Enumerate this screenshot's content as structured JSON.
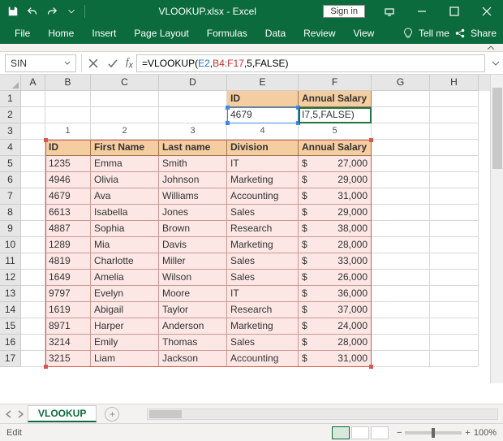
{
  "title": "VLOOKUP.xlsx - Excel",
  "signin": "Sign in",
  "tabs": [
    "File",
    "Home",
    "Insert",
    "Page Layout",
    "Formulas",
    "Data",
    "Review",
    "View"
  ],
  "tell_me": "Tell me",
  "share": "Share",
  "name_box": "SIN",
  "formula_prefix": "=VLOOKUP(",
  "formula_arg1": "E2",
  "formula_arg2": "B4:F17",
  "formula_rest": ",5,FALSE)",
  "col_headers": [
    "A",
    "B",
    "C",
    "D",
    "E",
    "F",
    "G",
    "H"
  ],
  "row_guides": [
    "1",
    "2",
    "3",
    "4",
    "5"
  ],
  "lookup": {
    "id_label": "ID",
    "salary_label": "Annual Salary",
    "id_value": "4679",
    "editing": "I7,5,FALSE)"
  },
  "table": {
    "headers": [
      "ID",
      "First Name",
      "Last name",
      "Division",
      "Annual Salary"
    ],
    "rows": [
      {
        "id": "1235",
        "fn": "Emma",
        "ln": "Smith",
        "div": "IT",
        "sal": "27,000"
      },
      {
        "id": "4946",
        "fn": "Olivia",
        "ln": "Johnson",
        "div": "Marketing",
        "sal": "29,000"
      },
      {
        "id": "4679",
        "fn": "Ava",
        "ln": "Williams",
        "div": "Accounting",
        "sal": "31,000"
      },
      {
        "id": "6613",
        "fn": "Isabella",
        "ln": "Jones",
        "div": "Sales",
        "sal": "29,000"
      },
      {
        "id": "4887",
        "fn": "Sophia",
        "ln": "Brown",
        "div": "Research",
        "sal": "38,000"
      },
      {
        "id": "1289",
        "fn": "Mia",
        "ln": "Davis",
        "div": "Marketing",
        "sal": "28,000"
      },
      {
        "id": "4819",
        "fn": "Charlotte",
        "ln": "Miller",
        "div": "Sales",
        "sal": "33,000"
      },
      {
        "id": "1649",
        "fn": "Amelia",
        "ln": "Wilson",
        "div": "Sales",
        "sal": "26,000"
      },
      {
        "id": "9797",
        "fn": "Evelyn",
        "ln": "Moore",
        "div": "IT",
        "sal": "36,000"
      },
      {
        "id": "1619",
        "fn": "Abigail",
        "ln": "Taylor",
        "div": "Research",
        "sal": "37,000"
      },
      {
        "id": "8971",
        "fn": "Harper",
        "ln": "Anderson",
        "div": "Marketing",
        "sal": "24,000"
      },
      {
        "id": "3214",
        "fn": "Emily",
        "ln": "Thomas",
        "div": "Sales",
        "sal": "28,000"
      },
      {
        "id": "3215",
        "fn": "Liam",
        "ln": "Jackson",
        "div": "Accounting",
        "sal": "31,000"
      }
    ]
  },
  "currency": "$",
  "sheet_tab": "VLOOKUP",
  "status_mode": "Edit",
  "zoom": "100%"
}
